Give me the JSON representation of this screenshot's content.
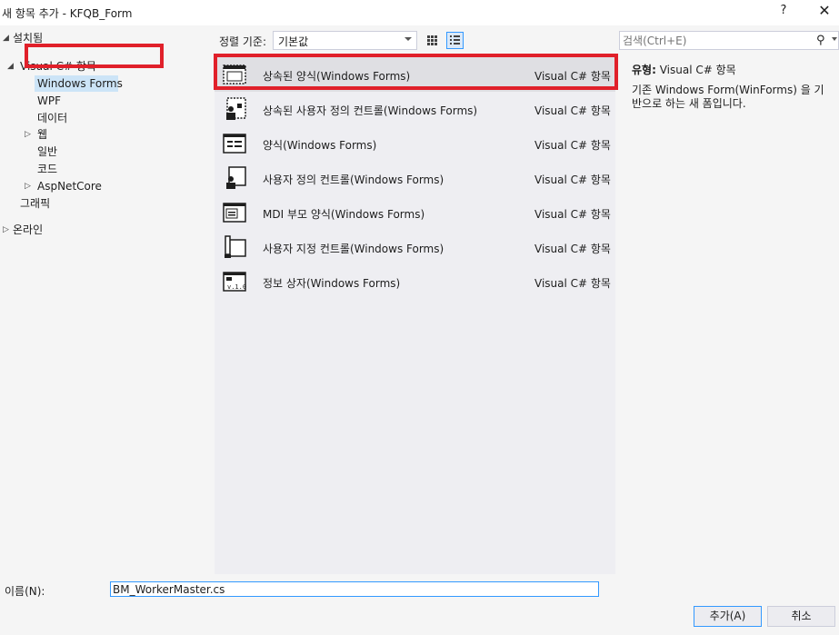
{
  "window": {
    "title": "새 항목 추가 - KFQB_Form",
    "help_glyph": "?",
    "close_glyph": "✕"
  },
  "tree": {
    "installed": "설치됨",
    "visual_csharp": "Visual C# 항목",
    "windows_forms": "Windows Forms",
    "wpf": "WPF",
    "data": "데이터",
    "web": "웹",
    "general": "일반",
    "code": "코드",
    "aspnetcore": "AspNetCore",
    "graphics": "그래픽",
    "online": "온라인"
  },
  "toolbar": {
    "sort_label": "정렬 기준:",
    "sort_value": "기본값"
  },
  "search": {
    "placeholder": "검색(Ctrl+E)"
  },
  "items": [
    {
      "name": "상속된 양식(Windows Forms)",
      "type": "Visual C# 항목",
      "icon": "inherited-form-icon"
    },
    {
      "name": "상속된 사용자 정의 컨트롤(Windows Forms)",
      "type": "Visual C# 항목",
      "icon": "inherited-user-control-icon"
    },
    {
      "name": "양식(Windows Forms)",
      "type": "Visual C# 항목",
      "icon": "form-icon"
    },
    {
      "name": "사용자 정의 컨트롤(Windows Forms)",
      "type": "Visual C# 항목",
      "icon": "user-control-icon"
    },
    {
      "name": "MDI 부모 양식(Windows Forms)",
      "type": "Visual C# 항목",
      "icon": "mdi-parent-form-icon"
    },
    {
      "name": "사용자 지정 컨트롤(Windows Forms)",
      "type": "Visual C# 항목",
      "icon": "custom-control-icon"
    },
    {
      "name": "정보 상자(Windows Forms)",
      "type": "Visual C# 항목",
      "icon": "about-box-icon"
    }
  ],
  "details": {
    "type_label": "유형:",
    "type_value": "Visual C# 항목",
    "description": "기존 Windows Form(WinForms) 을 기반으로 하는 새 폼입니다."
  },
  "footer": {
    "name_label": "이름(N):",
    "name_value": "BM_WorkerMaster.cs",
    "add_button": "추가(A)",
    "cancel_button": "취소"
  },
  "colors": {
    "highlight_red": "#e0202a",
    "selection_blue": "#cce4f7",
    "focus_blue": "#3399ff"
  }
}
